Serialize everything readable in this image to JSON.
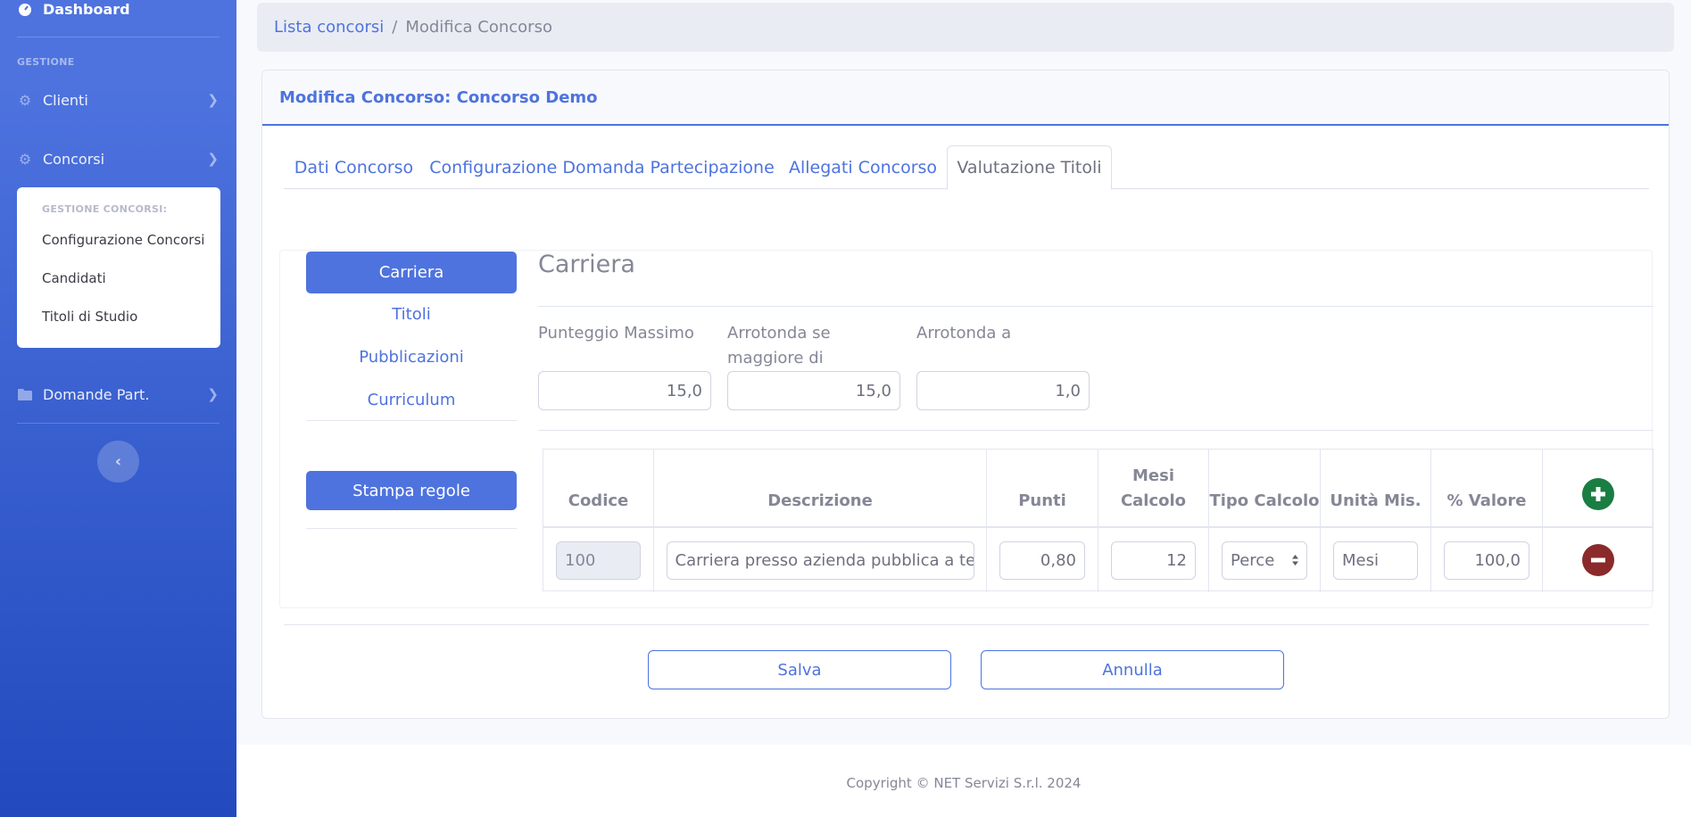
{
  "sidebar": {
    "dashboard": "Dashboard",
    "heading_gestione": "GESTIONE",
    "clienti": "Clienti",
    "concorsi": "Concorsi",
    "submenu": {
      "heading": "GESTIONE CONCORSI:",
      "items": [
        "Configurazione Concorsi",
        "Candidati",
        "Titoli di Studio"
      ]
    },
    "domande": "Domande Part.",
    "icons": {
      "dashboard": "tachometer-icon",
      "clienti": "gear-icon",
      "concorsi": "gear-icon",
      "domande": "folder-icon",
      "toggle": "chevron-left-icon"
    }
  },
  "breadcrumb": {
    "link": "Lista concorsi",
    "separator": "/",
    "current": "Modifica Concorso"
  },
  "card": {
    "title": "Modifica Concorso: Concorso Demo"
  },
  "tabs": [
    "Dati Concorso",
    "Configurazione Domanda Partecipazione",
    "Allegati Concorso",
    "Valutazione Titoli"
  ],
  "active_tab": "Valutazione Titoli",
  "left_nav": {
    "items": [
      "Carriera",
      "Titoli",
      "Pubblicazioni",
      "Curriculum"
    ],
    "active": "Carriera",
    "print_button": "Stampa regole"
  },
  "section": {
    "title": "Carriera",
    "fields": {
      "punteggio_label": "Punteggio Massimo",
      "punteggio_value": "15,0",
      "arrotonda_magg_label": "Arrotonda se maggiore di",
      "arrotonda_magg_value": "15,0",
      "arrotonda_a_label": "Arrotonda a",
      "arrotonda_a_value": "1,0"
    }
  },
  "table": {
    "headers": [
      "Codice",
      "Descrizione",
      "Punti",
      "Mesi Calcolo",
      "Tipo Calcolo",
      "Unità Mis.",
      "% Valore"
    ],
    "rows": [
      {
        "codice": "100",
        "descrizione": "Carriera presso azienda pubblica a tem",
        "punti": "0,80",
        "mesi": "12",
        "tipo": "Perce",
        "unita": "Mesi",
        "valore": "100,0"
      }
    ]
  },
  "buttons": {
    "save": "Salva",
    "cancel": "Annulla"
  },
  "footer": {
    "copyright": "Copyright © NET Servizi S.r.l. 2024"
  },
  "colors": {
    "primary": "#4e73df",
    "add": "#1a7d42",
    "remove": "#8b2a2a"
  }
}
